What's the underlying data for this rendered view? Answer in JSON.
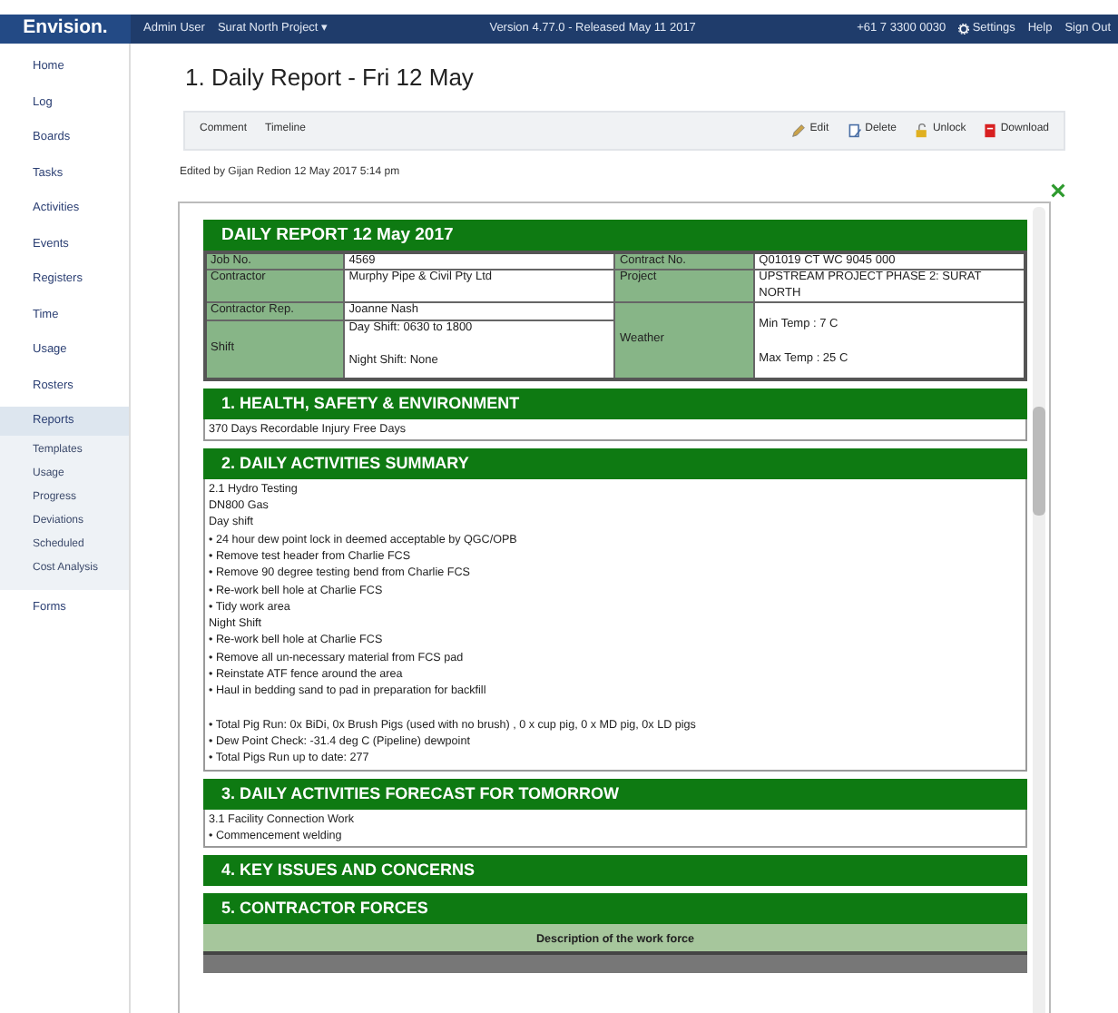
{
  "navbar": {
    "logo": "Envision.",
    "user": "Admin User",
    "project": "Surat North Project ▾",
    "version": "Version 4.77.0 - Released May 11 2017",
    "phone": "+61 7 3300 0030",
    "links": [
      "Settings",
      "Help",
      "Sign Out"
    ]
  },
  "sidebar": {
    "items": [
      {
        "label": "Home",
        "selected": false
      },
      {
        "label": "Log",
        "selected": false
      },
      {
        "label": "Boards",
        "selected": false
      },
      {
        "label": "Tasks",
        "selected": false
      },
      {
        "label": "Activities",
        "selected": false
      },
      {
        "label": "Events",
        "selected": false
      },
      {
        "label": "Registers",
        "selected": false
      },
      {
        "label": "Time",
        "selected": false
      },
      {
        "label": "Usage",
        "selected": false
      },
      {
        "label": "Rosters",
        "selected": false
      },
      {
        "label": "Reports",
        "selected": true,
        "children": [
          "Templates",
          "Usage",
          "Progress",
          "Deviations",
          "Scheduled",
          "Cost Analysis"
        ]
      },
      {
        "label": "Forms",
        "selected": false
      }
    ]
  },
  "page_title": "1. Daily Report - Fri 12 May",
  "toolbar": {
    "tabs": [
      "Comment",
      "Timeline"
    ],
    "actions": [
      "Edit",
      "Delete",
      "Unlock",
      "Download"
    ]
  },
  "edited_note": "Edited by Gijan Redion 12 May 2017 5:14 pm",
  "report": {
    "title": "DAILY REPORT 12 May 2017",
    "info_rows": [
      [
        {
          "label": "Job No.",
          "value": "4569"
        },
        {
          "label": "Contract No.",
          "value": "Q01019 CT WC 9045 000"
        }
      ],
      [
        {
          "label": "Contractor",
          "value": "Murphy Pipe & Civil Pty Ltd"
        },
        {
          "label": "Project",
          "value": "UPSTREAM PROJECT PHASE 2: SURAT NORTH"
        }
      ]
    ],
    "rep": {
      "label": "Contractor Rep.",
      "value": "Joanne Nash"
    },
    "shift": {
      "label": "Shift",
      "lines": [
        "Day Shift: 0630 to 1800",
        "Night Shift: None"
      ]
    },
    "weather": {
      "label": "Weather",
      "lines": [
        "Min Temp : 7 C",
        "Max Temp : 25 C"
      ]
    },
    "sections": [
      {
        "title": "1. HEALTH, SAFETY & ENVIRONMENT",
        "paragraphs": [
          [
            "370 Days Recordable Injury Free Days"
          ]
        ]
      },
      {
        "title": "2. DAILY ACTIVITIES SUMMARY",
        "paragraphs": [
          [
            "2.1 Hydro Testing",
            "DN800 Gas",
            "Day shift",
            "• 24 hour dew point lock in deemed acceptable by QGC/OPB",
            "• Remove test header from Charlie FCS",
            "• Remove 90 degree testing bend from Charlie FCS",
            "• Re-work bell hole at Charlie FCS",
            "• Tidy work area",
            "Night Shift",
            "• Re-work bell hole at Charlie FCS",
            "• Remove all un-necessary material from FCS pad",
            "• Reinstate ATF fence around the area",
            "• Haul in bedding sand to pad in preparation for backfill"
          ],
          [
            "• Total Pig Run: 0x BiDi, 0x Brush Pigs (used with no brush) , 0 x cup pig, 0 x MD pig, 0x LD pigs",
            "• Dew Point Check: -31.4 deg C (Pipeline) dewpoint",
            "• Total Pigs Run up to date: 277"
          ]
        ]
      },
      {
        "title": "3. DAILY ACTIVITIES FORECAST FOR TOMORROW",
        "paragraphs": [
          [
            "3.1 Facility Connection Work",
            "• Commencement welding"
          ]
        ]
      },
      {
        "title": "4. KEY ISSUES AND CONCERNS"
      },
      {
        "title": "5. CONTRACTOR FORCES",
        "table_header": "Description of the work force"
      }
    ]
  }
}
